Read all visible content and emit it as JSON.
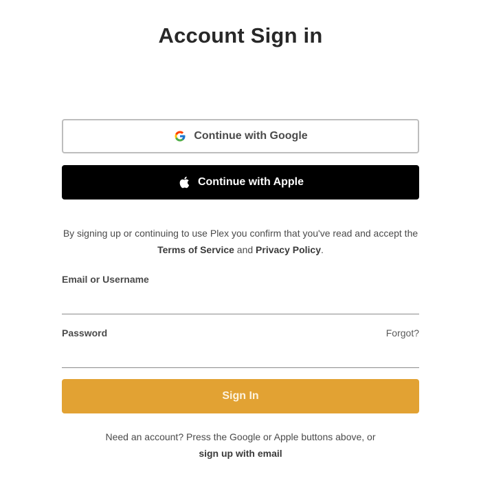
{
  "page": {
    "title": "Account Sign in"
  },
  "social": {
    "google_label": "Continue with Google",
    "google_icon": "google-g-icon",
    "apple_label": "Continue with Apple",
    "apple_icon": "apple-icon"
  },
  "legal": {
    "text_before": "By signing up or continuing to use Plex you confirm that you've read and accept the ",
    "terms_link": "Terms of Service",
    "conjunction": " and ",
    "privacy_link": "Privacy Policy",
    "text_after": "."
  },
  "form": {
    "email_label": "Email or Username",
    "email_value": "",
    "password_label": "Password",
    "password_value": "",
    "forgot_link": "Forgot?",
    "signin_label": "Sign In"
  },
  "footer": {
    "text": "Need an account? Press the Google or Apple buttons above, or",
    "signup_link": "sign up with email"
  },
  "colors": {
    "signin_button": "#e2a233",
    "apple_button": "#000000",
    "google_border": "#bdbdbd",
    "title_text": "#282828"
  }
}
